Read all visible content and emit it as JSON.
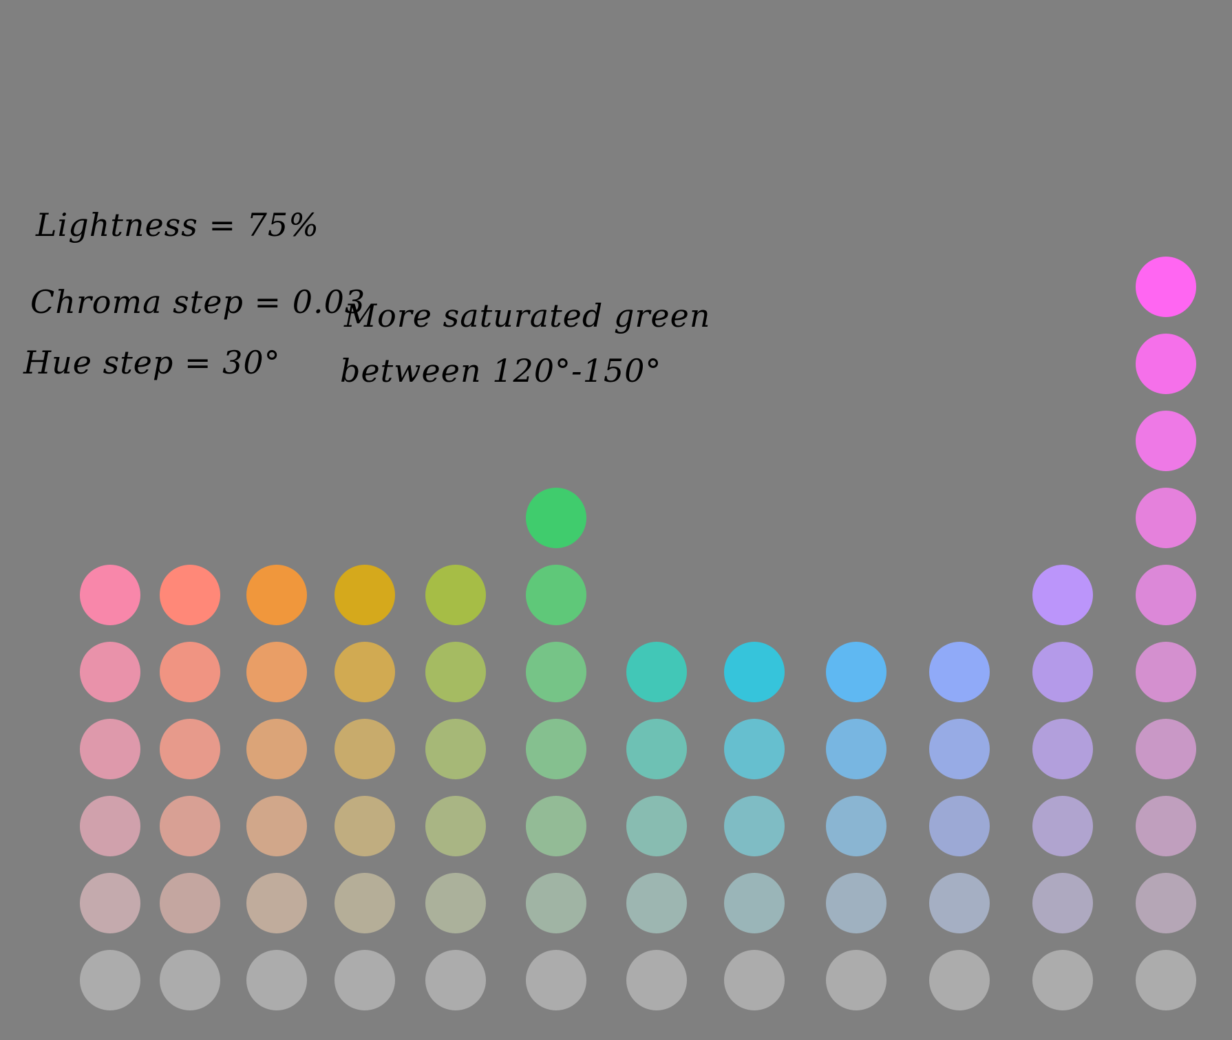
{
  "canvas": {
    "background": "#808080"
  },
  "notes": {
    "lightness": "Lightness = 75%",
    "chroma_step": "Chroma step = 0.03",
    "hue_step": "Hue step = 30°",
    "green_note_line1": "More saturated green",
    "green_note_line2": "between 120°-150°"
  },
  "swatches": {
    "columns": [
      {
        "hue_index": 0,
        "colors": [
          "#acacac",
          "#c4aaad",
          "#d0a1ac",
          "#de99ab",
          "#e992aa",
          "#f887aa"
        ]
      },
      {
        "hue_index": 1,
        "colors": [
          "#acacac",
          "#c4a6a0",
          "#d8a094",
          "#e79a8b",
          "#f09482",
          "#ff8878"
        ]
      },
      {
        "hue_index": 2,
        "colors": [
          "#acacac",
          "#c0ac9c",
          "#d1a78a",
          "#dba478",
          "#e99e66",
          "#f0973c"
        ]
      },
      {
        "hue_index": 3,
        "colors": [
          "#acacac",
          "#b5ae98",
          "#c0ad80",
          "#c8ab6c",
          "#d1aa52",
          "#d5a91c"
        ]
      },
      {
        "hue_index": 4,
        "colors": [
          "#acacac",
          "#abb19b",
          "#a9b584",
          "#a6b877",
          "#a5bb62",
          "#a6bd46"
        ]
      },
      {
        "hue_index": 5,
        "colors": [
          "#acacac",
          "#a0b4a4",
          "#93bb96",
          "#85c08f",
          "#76c487",
          "#5fc879",
          "#40cc6d"
        ]
      },
      {
        "hue_index": 6,
        "colors": [
          "#acacac",
          "#9db6b1",
          "#88bcb1",
          "#6ec1b4",
          "#42c7b7"
        ]
      },
      {
        "hue_index": 7,
        "colors": [
          "#acacac",
          "#9ab5b8",
          "#7fbcc4",
          "#66bfcf",
          "#36c4db"
        ]
      },
      {
        "hue_index": 8,
        "colors": [
          "#acacac",
          "#9fb1c0",
          "#8ab5d2",
          "#78b6e1",
          "#5fb8f2"
        ]
      },
      {
        "hue_index": 9,
        "colors": [
          "#acacac",
          "#a5afc3",
          "#9ca9d5",
          "#97abe5",
          "#90aaf8"
        ]
      },
      {
        "hue_index": 10,
        "colors": [
          "#acacac",
          "#aea9c0",
          "#b0a4cf",
          "#b29fdc",
          "#b49ae9",
          "#bb95fa"
        ]
      },
      {
        "hue_index": 11,
        "colors": [
          "#acacac",
          "#b5a6b6",
          "#c09fbe",
          "#c998c6",
          "#d490cf",
          "#dc88d8",
          "#e581dc",
          "#ee79e6",
          "#f570ea",
          "#ff66f2"
        ]
      }
    ]
  }
}
